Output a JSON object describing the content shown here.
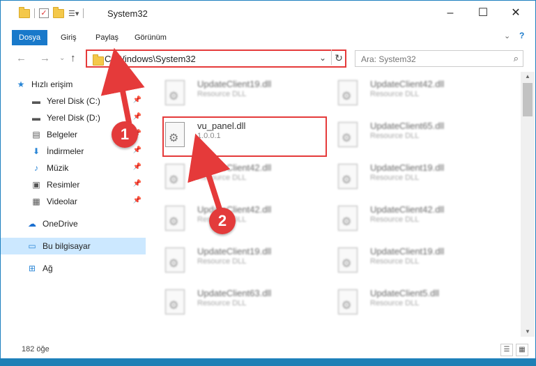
{
  "title": "System32",
  "tabs": [
    {
      "label": "Dosya"
    },
    {
      "label": "Giriş"
    },
    {
      "label": "Paylaş"
    },
    {
      "label": "Görünüm"
    }
  ],
  "address": {
    "path": "C:\\Windows\\System32"
  },
  "search": {
    "placeholder": "Ara: System32"
  },
  "nav": [
    {
      "label": "Hızlı erişim",
      "icon": "star-icon"
    },
    {
      "label": "Yerel Disk (C:)",
      "icon": "drive-icon",
      "pinned": true
    },
    {
      "label": "Yerel Disk (D:)",
      "icon": "drive-icon",
      "pinned": true
    },
    {
      "label": "Belgeler",
      "icon": "documents-icon",
      "pinned": true
    },
    {
      "label": "İndirmeler",
      "icon": "download-icon",
      "pinned": true
    },
    {
      "label": "Müzik",
      "icon": "music-icon",
      "pinned": true
    },
    {
      "label": "Resimler",
      "icon": "pictures-icon",
      "pinned": true
    },
    {
      "label": "Videolar",
      "icon": "videos-icon",
      "pinned": true
    },
    {
      "label": "OneDrive",
      "icon": "cloud-icon"
    },
    {
      "label": "Bu bilgisayar",
      "icon": "computer-icon"
    },
    {
      "label": "Ağ",
      "icon": "network-icon"
    }
  ],
  "files": [
    {
      "name": "UpdateClient19.dll",
      "desc": "Resource DLL"
    },
    {
      "name": "UpdateClient42.dll",
      "desc": "Resource DLL"
    },
    {
      "name": "vu_panel.dll",
      "version": "1.0.0.1",
      "company": "vu"
    },
    {
      "name": "UpdateClient65.dll",
      "desc": "Resource DLL"
    },
    {
      "name": "UpdateClient42.dll",
      "desc": "Resource DLL"
    },
    {
      "name": "UpdateClient19.dll",
      "desc": "Resource DLL"
    },
    {
      "name": "UpdateClient42.dll",
      "desc": "Resource DLL"
    },
    {
      "name": "UpdateClient42.dll",
      "desc": "Resource DLL"
    },
    {
      "name": "UpdateClient19.dll",
      "desc": "Resource DLL"
    },
    {
      "name": "UpdateClient19.dll",
      "desc": "Resource DLL"
    },
    {
      "name": "UpdateClient63.dll",
      "desc": "Resource DLL"
    },
    {
      "name": "UpdateClient5.dll",
      "desc": "Resource DLL"
    }
  ],
  "status": {
    "count": "182 öğe"
  },
  "markers": [
    "1",
    "2"
  ],
  "colors": {
    "accent": "#1979ca",
    "highlight": "#e53a3a"
  }
}
